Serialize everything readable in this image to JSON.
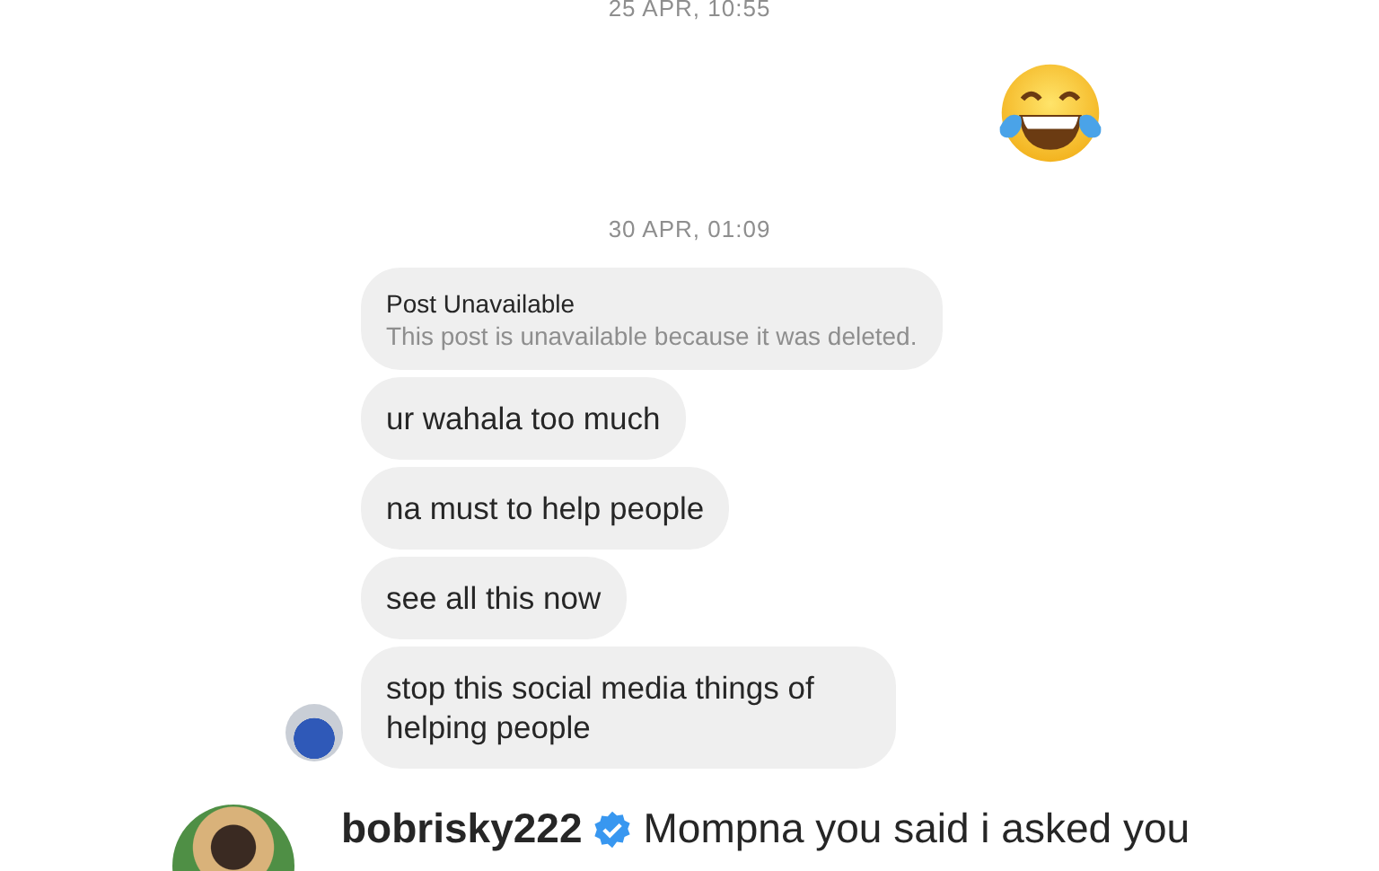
{
  "conversation": {
    "items": [
      {
        "kind": "timestamp",
        "text": "25 APR, 10:55"
      },
      {
        "kind": "emoji"
      },
      {
        "kind": "timestamp",
        "text": "30 APR, 01:09"
      },
      {
        "kind": "group",
        "messages": [
          {
            "kind": "post",
            "title": "Post Unavailable",
            "text": "This post is unavailable because it was deleted."
          },
          {
            "kind": "text",
            "text": "ur wahala too much"
          },
          {
            "kind": "text",
            "text": "na must to help people"
          },
          {
            "kind": "text",
            "text": "see all this now"
          },
          {
            "kind": "text",
            "text": "stop this social media things of helping people"
          }
        ]
      }
    ]
  },
  "caption": {
    "username": "bobrisky222",
    "verified": true,
    "text": "Mompna you said i asked you"
  }
}
